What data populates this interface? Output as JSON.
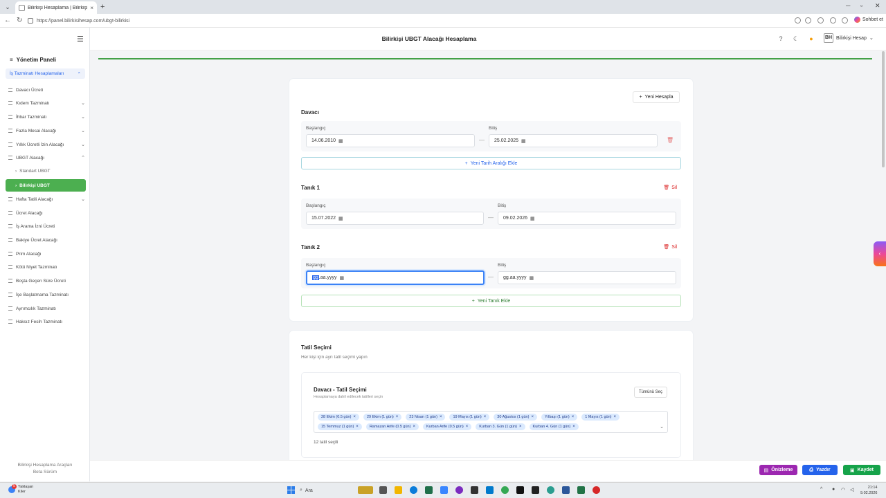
{
  "browser": {
    "tab_title": "Bilirkişi Hesaplama | Bilirkişi UBGT",
    "tab_close": "×",
    "new_tab": "+",
    "url": "https://panel.bilirkisihesap.com/ubgt-bilirkisi",
    "copilot_label": "Sohbet et"
  },
  "header": {
    "title": "Bilirkişi UBGT Alacağı Hesaplama",
    "user_name": "Bilirkişi Hesap",
    "user_initials": "BH"
  },
  "sidebar": {
    "title": "Yönetim Paneli",
    "group_label": "İş Tazminatı Hesaplamaları",
    "items": [
      {
        "label": "Davacı Ücreti",
        "chevron": ""
      },
      {
        "label": "Kıdem Tazminatı",
        "chevron": "⌄"
      },
      {
        "label": "İhbar Tazminatı",
        "chevron": "⌄"
      },
      {
        "label": "Fazla Mesai Alacağı",
        "chevron": "⌄"
      },
      {
        "label": "Yıllık Ücretli İzin Alacağı",
        "chevron": "⌄"
      },
      {
        "label": "UBGT Alacağı",
        "chevron": "⌃"
      }
    ],
    "sub_item": "Standart UBGT",
    "active_item": "Bilirkişi UBGT",
    "items_after": [
      {
        "label": "Hafta Tatili Alacağı",
        "chevron": "⌄"
      },
      {
        "label": "Ücret Alacağı",
        "chevron": ""
      },
      {
        "label": "İş Arama İzni Ücreti",
        "chevron": ""
      },
      {
        "label": "Bakiye Ücret Alacağı",
        "chevron": ""
      },
      {
        "label": "Prim Alacağı",
        "chevron": ""
      },
      {
        "label": "Kötü Niyet Tazminatı",
        "chevron": ""
      },
      {
        "label": "Boşta Geçen Süre Ücreti",
        "chevron": ""
      },
      {
        "label": "İşe Başlatmama Tazminatı",
        "chevron": ""
      },
      {
        "label": "Ayrımcılık Tazminatı",
        "chevron": ""
      },
      {
        "label": "Haksız Fesih Tazminatı",
        "chevron": ""
      }
    ],
    "footer_line1": "Bilirkişi Hesaplama Araçları",
    "footer_line2": "Beta Sürüm"
  },
  "form": {
    "new_calc_label": "Yeni Hesapla",
    "davaci": {
      "title": "Davacı",
      "start_label": "Başlangıç",
      "start_value": "14.06.2010",
      "end_label": "Bitiş",
      "end_value": "25.02.2025",
      "add_range_label": "Yeni Tarih Aralığı Ekle"
    },
    "tanik1": {
      "title": "Tanık 1",
      "delete_label": "Sil",
      "start_label": "Başlangıç",
      "start_value": "15.07.2022",
      "end_label": "Bitiş",
      "end_value": "09.02.2026"
    },
    "tanik2": {
      "title": "Tanık 2",
      "delete_label": "Sil",
      "start_label": "Başlangıç",
      "start_selected": "gg",
      "start_rest": ".aa.yyyy",
      "end_label": "Bitiş",
      "end_value": "gg.aa.yyyy"
    },
    "add_witness_label": "Yeni Tanık Ekle"
  },
  "holidays": {
    "title": "Tatil Seçimi",
    "subtitle": "Her kişi için ayrı tatil seçimi yapın",
    "inner_title": "Davacı - Tatil Seçimi",
    "inner_subtitle": "Hesaplamaya dahil edilecek tatilleri seçin",
    "select_all_label": "Tümünü Seç",
    "chips": [
      "28 Ekim (0.5 gün)",
      "29 Ekim (1 gün)",
      "23 Nisan (1 gün)",
      "19 Mayıs (1 gün)",
      "30 Ağustos (1 gün)",
      "Yılbaşı (1 gün)",
      "1 Mayıs (1 gün)",
      "15 Temmuz (1 gün)",
      "Ramazan Arife (0.5 gün)",
      "Kurban Arife (0.5 gün)",
      "Kurban 3. Gün (1 gün)",
      "Kurban 4. Gün (1 gün)"
    ],
    "count_label": "12 tatil seçili"
  },
  "actions": {
    "preview_label": "Önizleme",
    "print_label": "Yazdır",
    "save_label": "Kaydet"
  },
  "taskbar": {
    "weather_line1": "Yaklaşan",
    "weather_line2": "Kiler",
    "weather_badge": "5",
    "search_placeholder": "Ara",
    "time": "21:14",
    "date": "9.02.2026"
  },
  "colors": {
    "accent_green": "#4caf50",
    "preview_purple": "#9c27b0",
    "print_blue": "#2563eb",
    "save_green": "#16a34a"
  }
}
